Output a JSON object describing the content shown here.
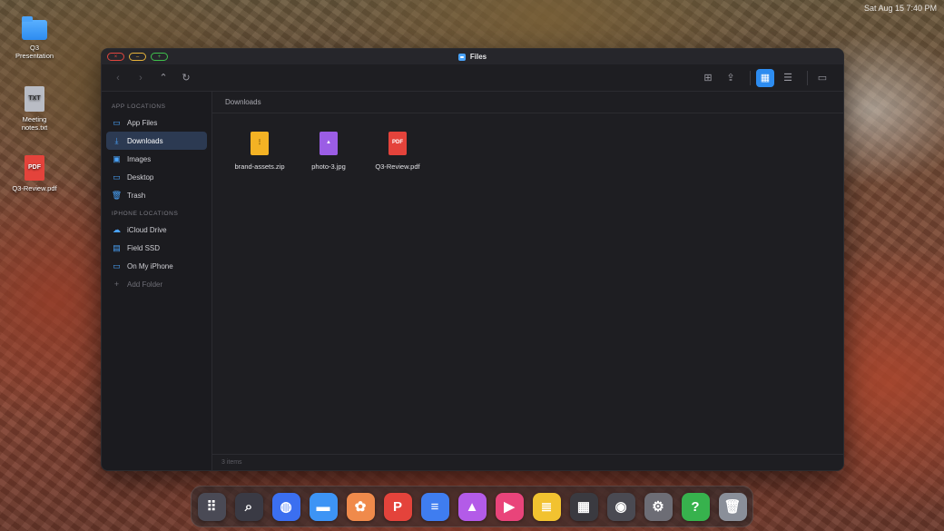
{
  "status_bar": {
    "datetime": "Sat Aug 15 7:40 PM"
  },
  "desktop": {
    "icons": [
      {
        "label": "Q3 Presentation",
        "type": "folder"
      },
      {
        "label": "Meeting notes.txt",
        "type": "txt",
        "badge": "TXT"
      },
      {
        "label": "Q3-Review.pdf",
        "type": "pdf",
        "badge": "PDF"
      }
    ]
  },
  "window": {
    "title": "Files",
    "traffic": {
      "close": "×",
      "minimize": "–",
      "maximize": "+"
    },
    "toolbar": {
      "back": "‹",
      "forward": "›",
      "up": "⌃",
      "refresh": "↻",
      "new_folder": "⊞",
      "share": "⇪",
      "grid_view": "▦",
      "list_view": "☰",
      "airplay": "▭"
    },
    "sidebar": {
      "app_section": "App Locations",
      "app_items": [
        {
          "label": "App Files",
          "icon": "folder-icon",
          "glyph": "▭"
        },
        {
          "label": "Downloads",
          "icon": "download-icon",
          "glyph": "⤓",
          "selected": true
        },
        {
          "label": "Images",
          "icon": "image-icon",
          "glyph": "▣"
        },
        {
          "label": "Desktop",
          "icon": "monitor-icon",
          "glyph": "▭"
        },
        {
          "label": "Trash",
          "icon": "trash-icon",
          "glyph": "🗑"
        }
      ],
      "iphone_section": "iPhone Locations",
      "iphone_items": [
        {
          "label": "iCloud Drive",
          "icon": "cloud-icon",
          "glyph": "☁"
        },
        {
          "label": "Field SSD",
          "icon": "drive-icon",
          "glyph": "▤"
        },
        {
          "label": "On My iPhone",
          "icon": "folder-icon",
          "glyph": "▭"
        }
      ],
      "add_folder": {
        "label": "Add Folder",
        "glyph": "+"
      }
    },
    "path": "Downloads",
    "files": [
      {
        "name": "brand-assets.zip",
        "type": "zip",
        "badge": "⋮"
      },
      {
        "name": "photo-3.jpg",
        "type": "img",
        "badge": "▲"
      },
      {
        "name": "Q3-Review.pdf",
        "type": "pdf",
        "badge": "PDF"
      }
    ],
    "item_count": "3 items"
  },
  "dock": {
    "apps": [
      {
        "name": "launchpad-icon",
        "glyph": "⠿",
        "color": "#4a4a55"
      },
      {
        "name": "finder-search-icon",
        "glyph": "⌕",
        "color": "#3a3a44"
      },
      {
        "name": "browser-icon",
        "glyph": "◍",
        "color": "#3b6ff0"
      },
      {
        "name": "files-icon",
        "glyph": "▬",
        "color": "#3d94f5"
      },
      {
        "name": "photos-icon",
        "glyph": "✿",
        "color": "#f08a4b"
      },
      {
        "name": "pdf-icon",
        "glyph": "P",
        "color": "#e4433b"
      },
      {
        "name": "docs-icon",
        "glyph": "≡",
        "color": "#3f7df0"
      },
      {
        "name": "gallery-icon",
        "glyph": "▲",
        "color": "#b35be8"
      },
      {
        "name": "video-icon",
        "glyph": "▶",
        "color": "#e9447a"
      },
      {
        "name": "notes-icon",
        "glyph": "≣",
        "color": "#f2c230"
      },
      {
        "name": "calculator-icon",
        "glyph": "▦",
        "color": "#3a3a40"
      },
      {
        "name": "camera-icon",
        "glyph": "◉",
        "color": "#4a4a52"
      },
      {
        "name": "settings-icon",
        "glyph": "⚙",
        "color": "#6d6d75"
      },
      {
        "name": "help-icon",
        "glyph": "?",
        "color": "#37b24d"
      },
      {
        "name": "trash-icon",
        "glyph": "🗑",
        "color": "#8a8f99"
      }
    ]
  }
}
